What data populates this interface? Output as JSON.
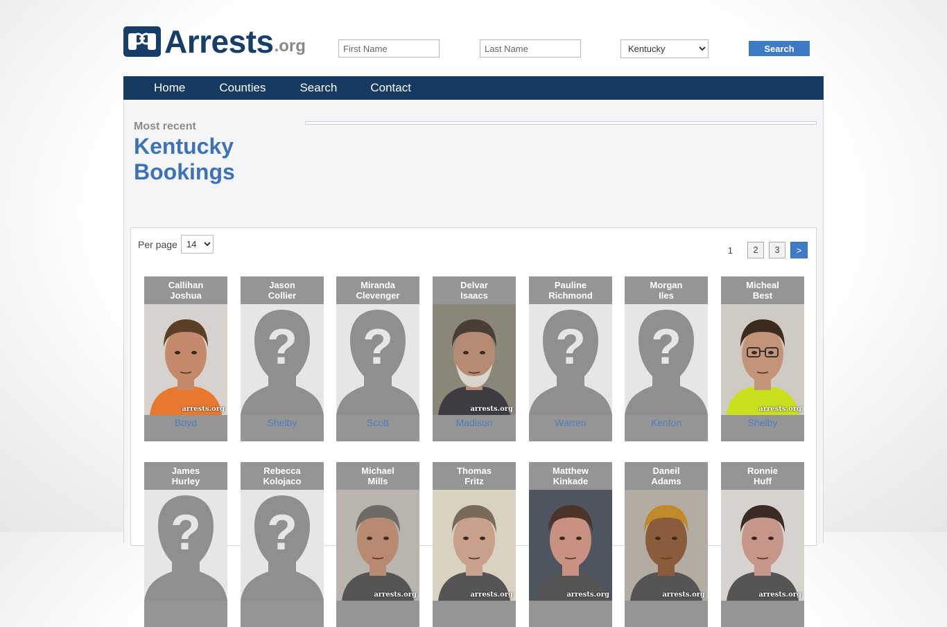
{
  "logo": {
    "main": "Arrests",
    "suffix": ".org"
  },
  "search": {
    "first_name_placeholder": "First Name",
    "last_name_placeholder": "Last Name",
    "state_selected": "Kentucky",
    "button_label": "Search"
  },
  "nav": {
    "items": [
      "Home",
      "Counties",
      "Search",
      "Contact"
    ]
  },
  "heading": {
    "kicker": "Most recent",
    "line1": "Kentucky",
    "line2": "Bookings"
  },
  "listing": {
    "per_page_label": "Per page",
    "per_page_value": "14",
    "pagination": {
      "current": "1",
      "pages": [
        "2",
        "3"
      ],
      "next": ">"
    }
  },
  "watermark": "arrests.org",
  "colors": {
    "brand": "#163e68",
    "nav_bg": "#173a61",
    "accent": "#3f7ac6",
    "title_blue": "#3d72b7",
    "card_bg": "#959595"
  },
  "inmates": [
    {
      "first": "Callihan",
      "last": "Joshua",
      "county": "Boyd",
      "photo": "photo",
      "tone": "#c58a6c",
      "hair": "#5b3f27",
      "shirt": "#e8782e",
      "bg": "#d7d2ce",
      "beard": false,
      "glasses": false
    },
    {
      "first": "Jason",
      "last": "Collier",
      "county": "Shelby",
      "photo": "placeholder"
    },
    {
      "first": "Miranda",
      "last": "Clevenger",
      "county": "Scott",
      "photo": "placeholder"
    },
    {
      "first": "Delvar",
      "last": "Isaacs",
      "county": "Madison",
      "photo": "photo",
      "tone": "#b58b74",
      "hair": "#4a3f37",
      "shirt": "#3e3c42",
      "bg": "#8a8678",
      "beard": true,
      "glasses": false
    },
    {
      "first": "Pauline",
      "last": "Richmond",
      "county": "Warren",
      "photo": "placeholder"
    },
    {
      "first": "Morgan",
      "last": "Iles",
      "county": "Kenton",
      "photo": "placeholder"
    },
    {
      "first": "Micheal",
      "last": "Best",
      "county": "Shelby",
      "photo": "photo",
      "tone": "#c49478",
      "hair": "#3d2b1d",
      "shirt": "#c9e01f",
      "bg": "#cfcbc4",
      "beard": false,
      "glasses": true
    },
    {
      "first": "James",
      "last": "Hurley",
      "county": "",
      "photo": "placeholder"
    },
    {
      "first": "Rebecca",
      "last": "Kolojaco",
      "county": "",
      "photo": "placeholder"
    },
    {
      "first": "Michael",
      "last": "Mills",
      "county": "",
      "photo": "photo",
      "tone": "#b88a72",
      "hair": "#6e6a66",
      "shirt": "#555",
      "bg": "#b9b5ae",
      "beard": false,
      "glasses": false
    },
    {
      "first": "Thomas",
      "last": "Fritz",
      "county": "",
      "photo": "photo",
      "tone": "#c9a08a",
      "hair": "#7a6a5c",
      "shirt": "#555",
      "bg": "#d9d2c0",
      "beard": false,
      "glasses": false
    },
    {
      "first": "Matthew",
      "last": "Kinkade",
      "county": "",
      "photo": "photo",
      "tone": "#c89180",
      "hair": "#4b3528",
      "shirt": "#555",
      "bg": "#4e5560",
      "beard": false,
      "glasses": false
    },
    {
      "first": "Daneil",
      "last": "Adams",
      "county": "",
      "photo": "photo",
      "tone": "#8a5c3c",
      "hair": "#c08a2a",
      "shirt": "#555",
      "bg": "#b3aca2",
      "beard": false,
      "glasses": false
    },
    {
      "first": "Ronnie",
      "last": "Huff",
      "county": "",
      "photo": "photo",
      "tone": "#c7968a",
      "hair": "#3a2c24",
      "shirt": "#555",
      "bg": "#d6d3cf",
      "beard": false,
      "glasses": false
    }
  ]
}
